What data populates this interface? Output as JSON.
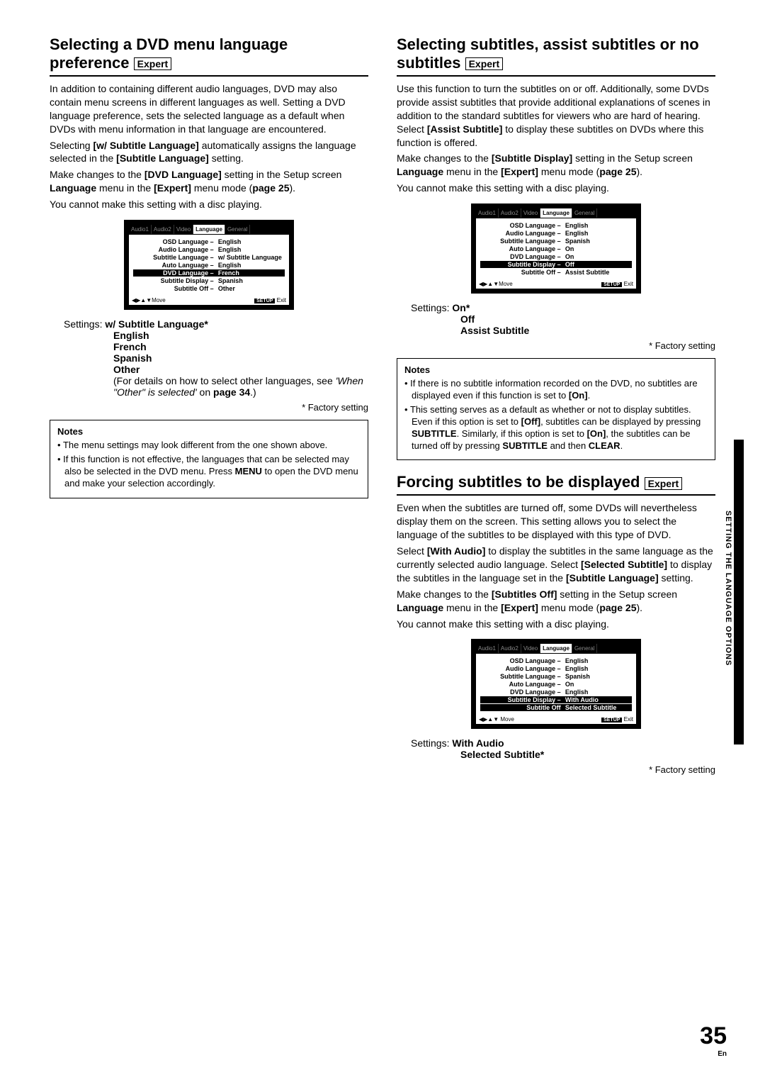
{
  "sideLabel": "SETTING THE LANGUAGE OPTIONS",
  "pageNum": "35",
  "pageLang": "En",
  "expertLabel": "Expert",
  "factorySetting": "* Factory setting",
  "settingsLabel": "Settings:",
  "notesTitle": "Notes",
  "screenTabs": [
    "Audio1",
    "Audio2",
    "Video",
    "Language",
    "General"
  ],
  "move": "Move",
  "setup": "SETUP",
  "exit": "Exit",
  "nav": "◀▶▲▼",
  "section1": {
    "title": "Selecting a DVD menu language preference",
    "p1a": "In addition to containing different audio languages, DVD may also contain menu screens in different languages as well. Setting a DVD language preference, sets the selected language as a default when DVDs with menu information in that language are encountered.",
    "p1b": "Selecting ",
    "p1bb": "[w/ Subtitle Language]",
    "p1c": " automatically assigns the language selected in the ",
    "p1cb": "[Subtitle Language]",
    "p1d": " setting.",
    "p2a": "Make changes to the ",
    "p2b": "[DVD Language]",
    "p2c": " setting in the Setup screen ",
    "p2d": "Language",
    "p2e": " menu in the ",
    "p2f": "[Expert]",
    "p2g": " menu mode (",
    "p2h": "page 25",
    "p2i": ").",
    "p3": "You cannot make this setting with a disc playing.",
    "screen": [
      {
        "l": "OSD Language –",
        "r": "English",
        "hl": false
      },
      {
        "l": "Audio Language –",
        "r": "English",
        "hl": false
      },
      {
        "l": "Subtitle Language –",
        "r": "w/ Subtitle Language",
        "hl": false
      },
      {
        "l": "Auto Language –",
        "r": "English",
        "hl": false
      },
      {
        "l": "DVD Language –",
        "r": "French",
        "hl": true
      },
      {
        "l": "Subtitle Display –",
        "r": "Spanish",
        "hl": false
      },
      {
        "l": "Subtitle Off –",
        "r": "Other",
        "hl": false
      }
    ],
    "options": [
      "w/ Subtitle Language*",
      "English",
      "French",
      "Spanish",
      "Other"
    ],
    "forDetailsA": "(For details on how to select other languages, see ",
    "forDetailsB": "'When \"Other\" is selected'",
    "forDetailsC": " on ",
    "forDetailsD": "page 34",
    "forDetailsE": ".)",
    "note1": "The menu settings may look different from the one shown above.",
    "note2a": "If this function is not effective, the languages that can be selected may also be selected in the DVD menu. Press ",
    "note2b": "MENU",
    "note2c": " to open the DVD menu and make your selection accordingly."
  },
  "section2": {
    "title": "Selecting subtitles, assist subtitles or no subtitles",
    "p1a": "Use this function to turn the subtitles on or off. Additionally, some DVDs provide assist subtitles that provide additional explanations of scenes in addition to the standard subtitles for viewers who are hard of hearing. Select ",
    "p1b": "[Assist Subtitle]",
    "p1c": " to display these subtitles on DVDs where this function is offered.",
    "p2a": "Make changes to the ",
    "p2b": "[Subtitle Display]",
    "p2c": " setting in the Setup screen ",
    "p2d": "Language",
    "p2e": " menu in the ",
    "p2f": "[Expert]",
    "p2g": " menu mode (",
    "p2h": "page 25",
    "p2i": ").",
    "p3": "You cannot make this setting with a disc playing.",
    "screen": [
      {
        "l": "OSD Language –",
        "r": "English",
        "hl": false
      },
      {
        "l": "Audio Language –",
        "r": "English",
        "hl": false
      },
      {
        "l": "Subtitle Language –",
        "r": "Spanish",
        "hl": false
      },
      {
        "l": "Auto Language –",
        "r": "On",
        "hl": false
      },
      {
        "l": "DVD Language –",
        "r": "On",
        "hl": false
      },
      {
        "l": "Subtitle Display –",
        "r": "Off",
        "hl": true
      },
      {
        "l": "Subtitle Off –",
        "r": "Assist Subtitle",
        "hl": false
      }
    ],
    "options": [
      "On*",
      "Off",
      "Assist Subtitle"
    ],
    "note1a": "If there is no subtitle information recorded on the DVD, no subtitles are displayed even if this function is set to ",
    "note1b": "[On]",
    "note1c": ".",
    "note2a": "This setting serves as a default as whether or not to display subtitles. Even if this option is set to ",
    "note2b": "[Off]",
    "note2c": ", subtitles can be displayed by pressing ",
    "note2d": "SUBTITLE",
    "note2e": ". Similarly, if this option is set to ",
    "note2f": "[On]",
    "note2g": ", the subtitles can be turned off by pressing ",
    "note2h": "SUBTITLE",
    "note2i": " and then ",
    "note2j": "CLEAR",
    "note2k": "."
  },
  "section3": {
    "title": "Forcing subtitles to be displayed",
    "p1": "Even when the subtitles are turned off, some DVDs will nevertheless display them on the screen. This setting allows you to select the language of the subtitles to be displayed with this type of DVD.",
    "p2a": "Select ",
    "p2b": "[With Audio]",
    "p2c": " to display the subtitles in the same language as the currently selected audio language. Select ",
    "p2d": "[Selected Subtitle]",
    "p2e": " to display the subtitles in the language set in the ",
    "p2f": "[Subtitle Language]",
    "p2g": " setting.",
    "p3a": "Make changes to the ",
    "p3b": "[Subtitles Off]",
    "p3c": " setting in the Setup screen ",
    "p3d": "Language",
    "p3e": " menu in the ",
    "p3f": "[Expert]",
    "p3g": " menu mode (",
    "p3h": "page 25",
    "p3i": ").",
    "p4": "You cannot make this setting with a disc playing.",
    "screen": [
      {
        "l": "OSD Language –",
        "r": "English",
        "hl": false
      },
      {
        "l": "Audio Language –",
        "r": "English",
        "hl": false
      },
      {
        "l": "Subtitle Language –",
        "r": "Spanish",
        "hl": false
      },
      {
        "l": "Auto Language –",
        "r": "On",
        "hl": false
      },
      {
        "l": "DVD Language –",
        "r": "English",
        "hl": false
      },
      {
        "l": "Subtitle Display –",
        "r": "With Audio",
        "hl": true
      },
      {
        "l": "Subtitle Off",
        "r": "Selected Subtitle",
        "hl": true
      }
    ],
    "options": [
      "With Audio",
      "Selected Subtitle*"
    ]
  }
}
